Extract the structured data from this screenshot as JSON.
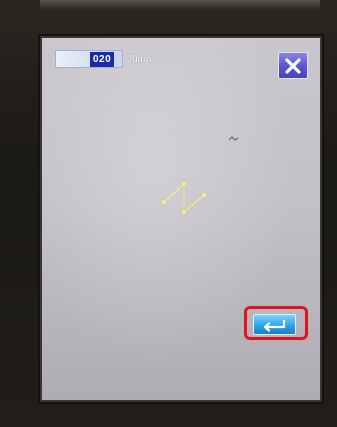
{
  "header": {
    "selector_prefix": "",
    "stitch_number": "020",
    "mode_label": "Jump"
  },
  "buttons": {
    "close": {
      "icon": "close-icon"
    },
    "enter": {
      "icon": "enter-icon",
      "highlighted": true
    }
  },
  "colors": {
    "close_button": "#5b53cf",
    "enter_button": "#2ea3e8",
    "highlight_outline": "#e0151b",
    "pattern_stroke": "#f2ee78",
    "stitch_number_bg": "#1a2aa8"
  }
}
